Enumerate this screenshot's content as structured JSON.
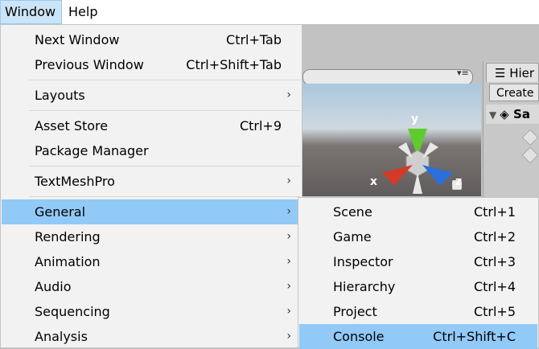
{
  "menubar": {
    "window": "Window",
    "help": "Help"
  },
  "window_menu": {
    "items": [
      {
        "label": "Next Window",
        "shortcut": "Ctrl+Tab"
      },
      {
        "label": "Previous Window",
        "shortcut": "Ctrl+Shift+Tab"
      },
      {
        "label": "Layouts",
        "has_submenu": true
      },
      {
        "label": "Asset Store",
        "shortcut": "Ctrl+9"
      },
      {
        "label": "Package Manager"
      },
      {
        "label": "TextMeshPro",
        "has_submenu": true
      },
      {
        "label": "General",
        "has_submenu": true,
        "highlighted": true
      },
      {
        "label": "Rendering",
        "has_submenu": true
      },
      {
        "label": "Animation",
        "has_submenu": true
      },
      {
        "label": "Audio",
        "has_submenu": true
      },
      {
        "label": "Sequencing",
        "has_submenu": true
      },
      {
        "label": "Analysis",
        "has_submenu": true
      }
    ],
    "submenu_arrow": "›"
  },
  "general_submenu": {
    "items": [
      {
        "label": "Scene",
        "shortcut": "Ctrl+1"
      },
      {
        "label": "Game",
        "shortcut": "Ctrl+2"
      },
      {
        "label": "Inspector",
        "shortcut": "Ctrl+3"
      },
      {
        "label": "Hierarchy",
        "shortcut": "Ctrl+4"
      },
      {
        "label": "Project",
        "shortcut": "Ctrl+5"
      },
      {
        "label": "Console",
        "shortcut": "Ctrl+Shift+C",
        "highlighted": true
      }
    ]
  },
  "editor": {
    "gizmo": {
      "y": "y",
      "x": "x",
      "z": "z"
    },
    "hierarchy_tab": "Hier",
    "create_button": "Create",
    "scene_name": "Sa",
    "dropdown_glyph": "▾≡"
  },
  "colors": {
    "highlight": "#91c9f7",
    "menu_bg": "#f2f2f2",
    "menubar_active": "#cce4f7"
  }
}
